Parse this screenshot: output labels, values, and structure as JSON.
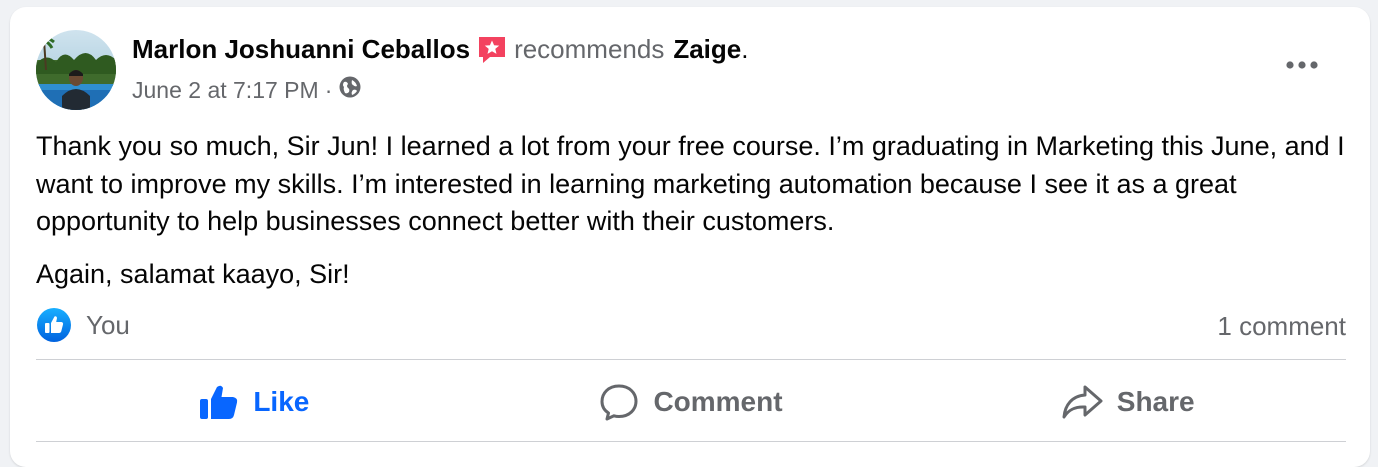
{
  "post": {
    "author": "Marlon Joshuanni Ceballos",
    "action_text": "recommends",
    "page_name": "Zaige",
    "trailing_period": ".",
    "timestamp": "June 2 at 7:17 PM",
    "separator": "·",
    "audience_icon": "globe-icon",
    "paragraphs": [
      "Thank you so much, Sir Jun! I learned a lot from your free course. I’m graduating in Marketing this June, and I want to improve my skills. I’m interested in learning marketing automation because I see it as a great opportunity to help businesses connect better with their customers.",
      "Again, salamat kaayo, Sir!"
    ],
    "more_icon": "more-options-icon"
  },
  "reactions": {
    "icon": "like-reaction-icon",
    "label": "You",
    "comment_count": "1 comment"
  },
  "actions": {
    "like": {
      "label": "Like",
      "icon": "thumbs-up-icon",
      "active": true
    },
    "comment": {
      "label": "Comment",
      "icon": "comment-bubble-icon"
    },
    "share": {
      "label": "Share",
      "icon": "share-arrow-icon"
    }
  },
  "colors": {
    "accent_blue": "#0866ff",
    "recommend_red": "#f3425f",
    "secondary_text": "#65676b",
    "divider": "#ced0d4"
  }
}
